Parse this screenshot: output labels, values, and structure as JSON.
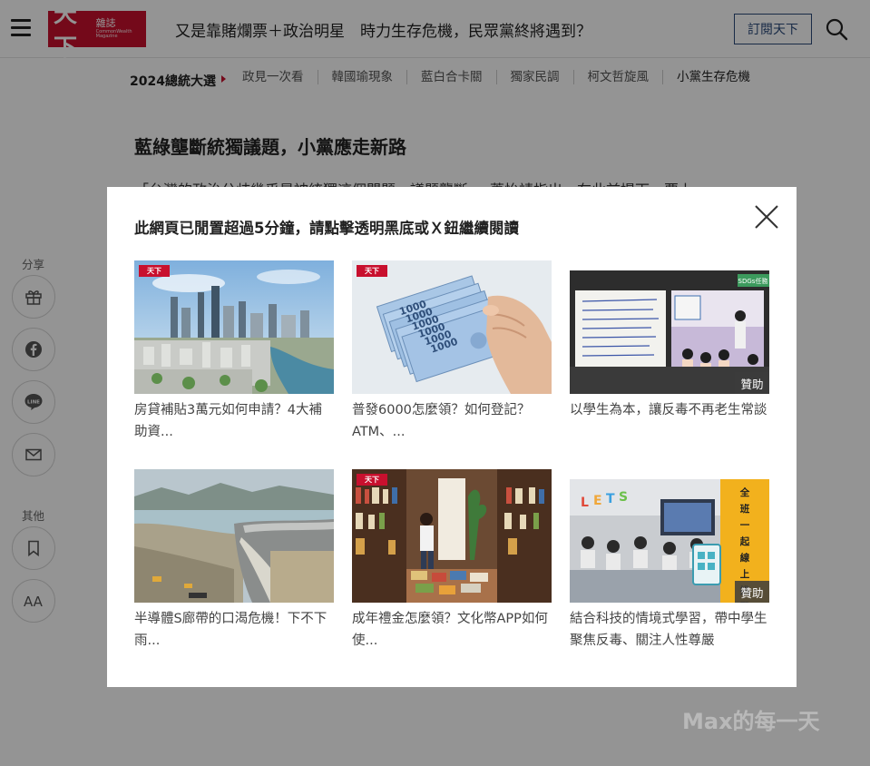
{
  "header": {
    "logo_text": "天下",
    "logo_sub": "雜誌",
    "logo_sub_en": "CommonWealth Magazine",
    "headline": "又是靠賭爛票＋政治明星　時力生存危機，民眾黨終將遇到？",
    "subscribe_label": "訂閱天下"
  },
  "topicbar": {
    "label": "2024總統大選",
    "items": [
      "政見一次看",
      "韓國瑜現象",
      "藍白合卡關",
      "獨家民調",
      "柯文哲旋風",
      "小黨生存危機"
    ]
  },
  "article": {
    "title": "藍綠壟斷統獨議題，小黨應走新路",
    "text": "「台灣的政治分歧幾乎是被統獨這個問題，議題壟斷，」蕭怡靖指出。在此前提下，要上"
  },
  "sidebar": {
    "share_label": "分享",
    "other_label": "其他",
    "buttons": [
      "gift-icon",
      "facebook-icon",
      "line-icon",
      "mail-icon",
      "bookmark-icon",
      "font-size-icon"
    ],
    "line_text": "LINE",
    "font_text": "AA"
  },
  "watermark": "Max的每一天",
  "modal": {
    "title": "此網頁已閒置超過5分鐘，請點擊透明黑底或Ｘ鈕繼續閱讀",
    "sponsor_label": "贊助",
    "cards": [
      {
        "caption": "房貸補貼3萬元如何申請？4大補助資...",
        "sponsored": false,
        "mini_logo": "天下"
      },
      {
        "caption": "普發6000怎麼領？如何登記？ATM、...",
        "sponsored": false,
        "mini_logo": "天下"
      },
      {
        "caption": "以學生為本，讓反毒不再老生常談",
        "sponsored": true,
        "mini_logo": ""
      },
      {
        "caption": "半導體S廊帶的口渴危機！下不下雨...",
        "sponsored": false,
        "mini_logo": ""
      },
      {
        "caption": "成年禮金怎麼領？文化幣APP如何使...",
        "sponsored": false,
        "mini_logo": "天下"
      },
      {
        "caption": "結合科技的情境式學習，帶中學生聚焦反毒、關注人性尊嚴",
        "sponsored": true,
        "mini_logo": ""
      }
    ],
    "banknote_value": "1000",
    "sdg_tag": "SDGs任務",
    "banner_text": "全班一起線上挑戰"
  }
}
